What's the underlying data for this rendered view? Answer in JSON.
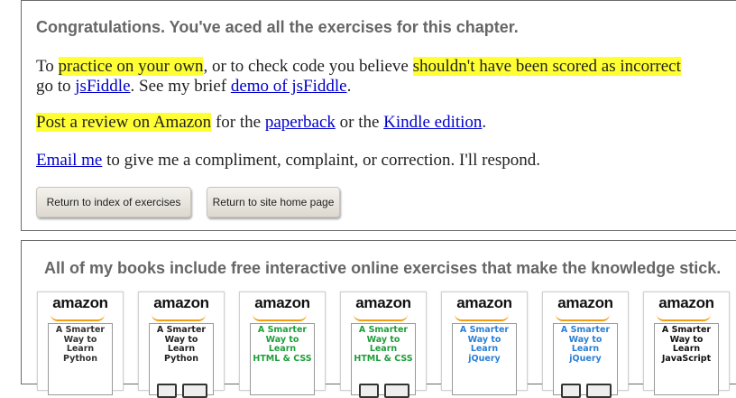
{
  "completion": {
    "heading": "Congratulations. You've aced all the exercises for this chapter.",
    "p1": {
      "t1": "To ",
      "h1": "practice on your own",
      "t2": ", or to check code you believe ",
      "h2": "shouldn't have been scored as incorrect",
      "t3": "go to ",
      "link_jsfiddle": "jsFiddle",
      "t4": ". See my brief ",
      "link_demo": "demo of jsFiddle",
      "t5": "."
    },
    "p2": {
      "h1": "Post a review on Amazon",
      "t1": " for the ",
      "link_paperback": "paperback",
      "t2": " or the ",
      "link_kindle": "Kindle edition",
      "t3": "."
    },
    "p3": {
      "link_email": "Email me",
      "t1": " to give me a compliment, complaint, or correction. I'll respond."
    },
    "buttons": {
      "index": "Return to index of exercises",
      "home": "Return to site home page"
    },
    "highlight_color": "#ffff33",
    "link_color": "#0000cc"
  },
  "books": {
    "heading": "All of my books include free interactive online exercises that make the knowledge stick.",
    "store_label": "amazon",
    "items": [
      {
        "title": "A Smarter\nWay to\nLearn\nPython",
        "color": "#333333",
        "icon": "none"
      },
      {
        "title": "A Smarter\nWay to\nLearn\nPython",
        "color": "#222222",
        "icon": "devices-icon"
      },
      {
        "title": "A Smarter\nWay to\nLearn\nHTML & CSS",
        "color": "#1e9e3a",
        "icon": "none"
      },
      {
        "title": "A Smarter\nWay to\nLearn\nHTML & CSS",
        "color": "#1e9e3a",
        "icon": "devices-icon"
      },
      {
        "title": "A Smarter\nWay to\nLearn\njQuery",
        "color": "#2a7fd4",
        "icon": "none"
      },
      {
        "title": "A Smarter\nWay to\nLearn\njQuery",
        "color": "#2a7fd4",
        "icon": "devices-icon"
      },
      {
        "title": "A Smarter\nWay to\nLearn\nJavaScript",
        "color": "#111111",
        "icon": "none"
      }
    ]
  }
}
